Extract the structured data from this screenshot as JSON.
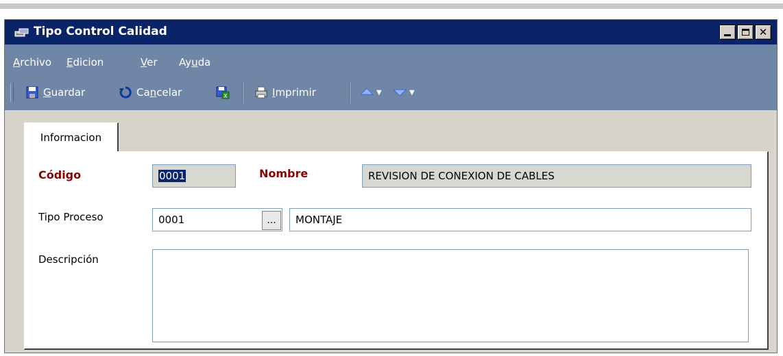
{
  "window": {
    "title": "Tipo Control Calidad",
    "title_bg": "#0a246a"
  },
  "menu": {
    "items": [
      {
        "label_u": "A",
        "label_rest": "rchivo"
      },
      {
        "label_u": "E",
        "label_rest": "dicion"
      },
      {
        "label_u": "V",
        "label_rest": "er"
      },
      {
        "label_pre": "Ay",
        "label_u": "u",
        "label_rest": "da"
      }
    ]
  },
  "toolbar": {
    "guardar_u": "G",
    "guardar_rest": "uardar",
    "cancelar_pre": "Ca",
    "cancelar_u": "n",
    "cancelar_rest": "celar",
    "imprimir_u": "I",
    "imprimir_rest": "mprimir",
    "icons": [
      "save-icon",
      "undo-icon",
      "excel-export-icon",
      "printer-icon",
      "up-arrow-icon",
      "down-arrow-icon"
    ]
  },
  "tabs": [
    {
      "label": "Informacion",
      "active": true
    }
  ],
  "form": {
    "codigo_label": "Código",
    "codigo_value": "0001",
    "nombre_label": "Nombre",
    "nombre_value": "REVISION DE CONEXION DE CABLES",
    "tipo_proceso_label": "Tipo Proceso",
    "tipo_proceso_code": "0001",
    "lookup_button": "...",
    "tipo_proceso_name": "MONTAJE",
    "descripcion_label": "Descripción",
    "descripcion_value": ""
  },
  "colors": {
    "menubar_bg": "#6f86a6",
    "required_label": "#8b0000",
    "readonly_field": "#d7d8cf"
  }
}
